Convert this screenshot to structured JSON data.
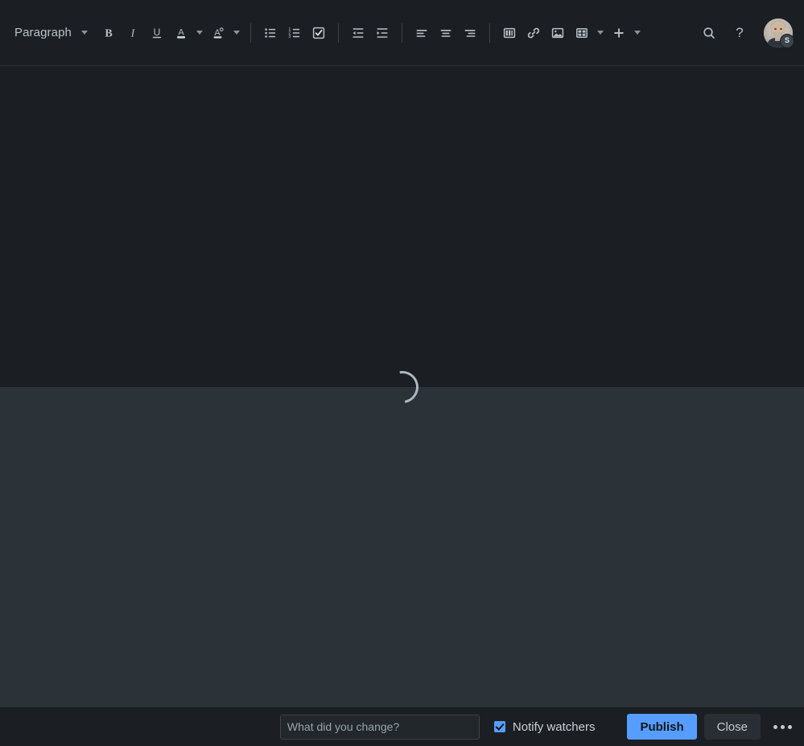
{
  "app": {
    "theme_bg": "#1b1f23",
    "panel_bg": "#2c3338",
    "accent": "#579dff"
  },
  "toolbar": {
    "block_style": {
      "label": "Paragraph",
      "icon": "chevron-down-icon"
    },
    "groups": [
      {
        "name": "text-format",
        "items": [
          {
            "name": "bold-button",
            "icon": "bold-icon",
            "label": "Bold"
          },
          {
            "name": "italic-button",
            "icon": "italic-icon",
            "label": "Italic"
          },
          {
            "name": "underline-button",
            "icon": "underline-icon",
            "label": "Underline"
          },
          {
            "name": "text-color-button",
            "icon": "text-color-icon",
            "label": "Text color"
          },
          {
            "name": "text-style-button",
            "icon": "clear-formatting-icon",
            "label": "More text styles"
          }
        ]
      },
      {
        "name": "lists",
        "items": [
          {
            "name": "bullet-list-button",
            "icon": "bullet-list-icon",
            "label": "Bulleted list"
          },
          {
            "name": "numbered-list-button",
            "icon": "numbered-list-icon",
            "label": "Numbered list"
          },
          {
            "name": "task-list-button",
            "icon": "task-list-icon",
            "label": "Action item"
          }
        ]
      },
      {
        "name": "indentation",
        "items": [
          {
            "name": "outdent-button",
            "icon": "outdent-icon",
            "label": "Decrease indent"
          },
          {
            "name": "indent-button",
            "icon": "indent-icon",
            "label": "Increase indent"
          }
        ]
      },
      {
        "name": "alignment",
        "items": [
          {
            "name": "align-left-button",
            "icon": "align-left-icon",
            "label": "Align left"
          },
          {
            "name": "align-center-button",
            "icon": "align-center-icon",
            "label": "Align center"
          },
          {
            "name": "align-right-button",
            "icon": "align-right-icon",
            "label": "Align right"
          }
        ]
      },
      {
        "name": "insert",
        "items": [
          {
            "name": "layouts-button",
            "icon": "layout-columns-icon",
            "label": "Layouts"
          },
          {
            "name": "link-button",
            "icon": "link-icon",
            "label": "Link"
          },
          {
            "name": "image-button",
            "icon": "image-icon",
            "label": "Image"
          },
          {
            "name": "table-button",
            "icon": "table-icon",
            "label": "Table"
          },
          {
            "name": "insert-more-button",
            "icon": "plus-icon",
            "label": "Insert more content"
          }
        ]
      }
    ],
    "search": {
      "name": "search-button",
      "icon": "search-icon",
      "label": "Find and replace"
    },
    "help": {
      "name": "help-button",
      "icon": "help-icon",
      "glyph": "?",
      "label": "Help"
    },
    "avatar": {
      "name": "user-avatar",
      "badge": "S",
      "label": "Account"
    }
  },
  "editor": {
    "status": "loading",
    "spinner_label": "Loading content"
  },
  "footer": {
    "change_comment": {
      "value": "",
      "placeholder": "What did you change?"
    },
    "notify_watchers": {
      "label": "Notify watchers",
      "checked": true
    },
    "publish_label": "Publish",
    "close_label": "Close",
    "more_label": "More actions"
  }
}
